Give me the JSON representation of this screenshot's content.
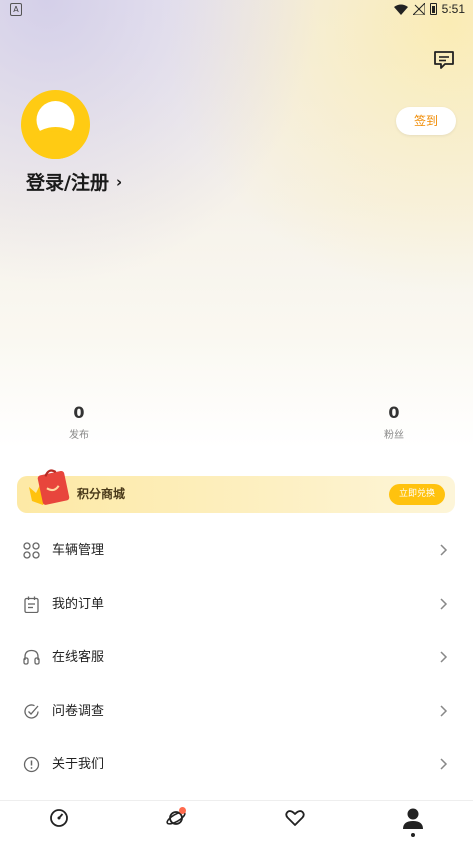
{
  "status_bar": {
    "time": "5:51",
    "left_icon": "A"
  },
  "header": {
    "message_icon": "chat-bubble-icon",
    "signin_label": "签到",
    "login_label": "登录/注册",
    "login_chevron": "›"
  },
  "stats": [
    {
      "value": "0",
      "label": "发布"
    },
    {
      "value": "0",
      "label": "粉丝"
    }
  ],
  "points_banner": {
    "title": "积分商城",
    "action": "立即兑换"
  },
  "menu": [
    {
      "label": "车辆管理",
      "icon": "grid-icon"
    },
    {
      "label": "我的订单",
      "icon": "clipboard-icon"
    },
    {
      "label": "在线客服",
      "icon": "headset-icon"
    },
    {
      "label": "问卷调查",
      "icon": "check-circle-icon"
    },
    {
      "label": "关于我们",
      "icon": "info-circle-icon"
    }
  ],
  "tabbar": [
    {
      "icon": "dashboard-icon",
      "active": false
    },
    {
      "icon": "planet-icon",
      "active": false,
      "badge": true
    },
    {
      "icon": "heart-icon",
      "active": false
    },
    {
      "icon": "profile-icon",
      "active": true
    }
  ],
  "colors": {
    "accent": "#ffcb13",
    "signin_text": "#f08a00",
    "badge": "#ff6a4d"
  }
}
